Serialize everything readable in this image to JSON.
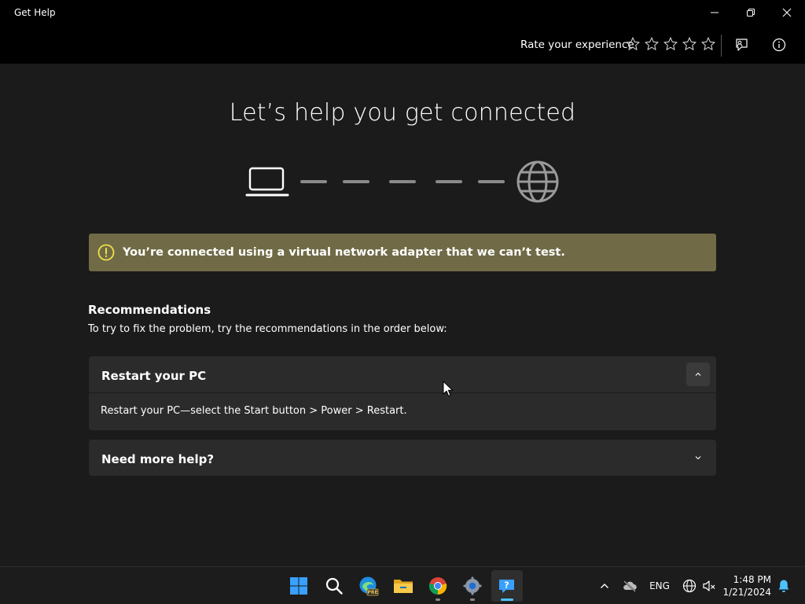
{
  "window": {
    "title": "Get Help",
    "minimize_icon": "minimize-icon",
    "restore_icon": "restore-icon",
    "close_icon": "close-icon"
  },
  "header": {
    "rate_label": "Rate your experience",
    "star_count": 5,
    "feedback_icon": "feedback-icon",
    "info_icon": "info-icon"
  },
  "main": {
    "title": "Let’s help you get connected",
    "connection_icons": [
      "laptop-icon",
      "globe-icon"
    ],
    "banner": {
      "text": "You’re connected using a virtual network adapter that we can’t test.",
      "icon": "warning-icon",
      "color": "#706b46"
    },
    "recommendations": {
      "heading": "Recommendations",
      "description": "To try to fix the problem, try the recommendations in the order below:",
      "items": [
        {
          "title": "Restart your PC",
          "body": "Restart your PC—select the Start button > Power > Restart.",
          "expanded": true
        },
        {
          "title": "Need more help?",
          "expanded": false
        }
      ]
    }
  },
  "taskbar": {
    "apps": [
      {
        "name": "start",
        "icon": "windows-start-icon"
      },
      {
        "name": "search",
        "icon": "search-icon"
      },
      {
        "name": "edge-preview",
        "icon": "edge-icon",
        "badge": "PRE"
      },
      {
        "name": "file-explorer",
        "icon": "folder-icon"
      },
      {
        "name": "chrome",
        "icon": "chrome-icon"
      },
      {
        "name": "settings",
        "icon": "gear-icon"
      },
      {
        "name": "get-help",
        "icon": "get-help-icon",
        "active": true
      }
    ],
    "tray": {
      "language": "ENG",
      "time": "1:48 PM",
      "date": "1/21/2024"
    },
    "accent": "#4cc2ff"
  }
}
